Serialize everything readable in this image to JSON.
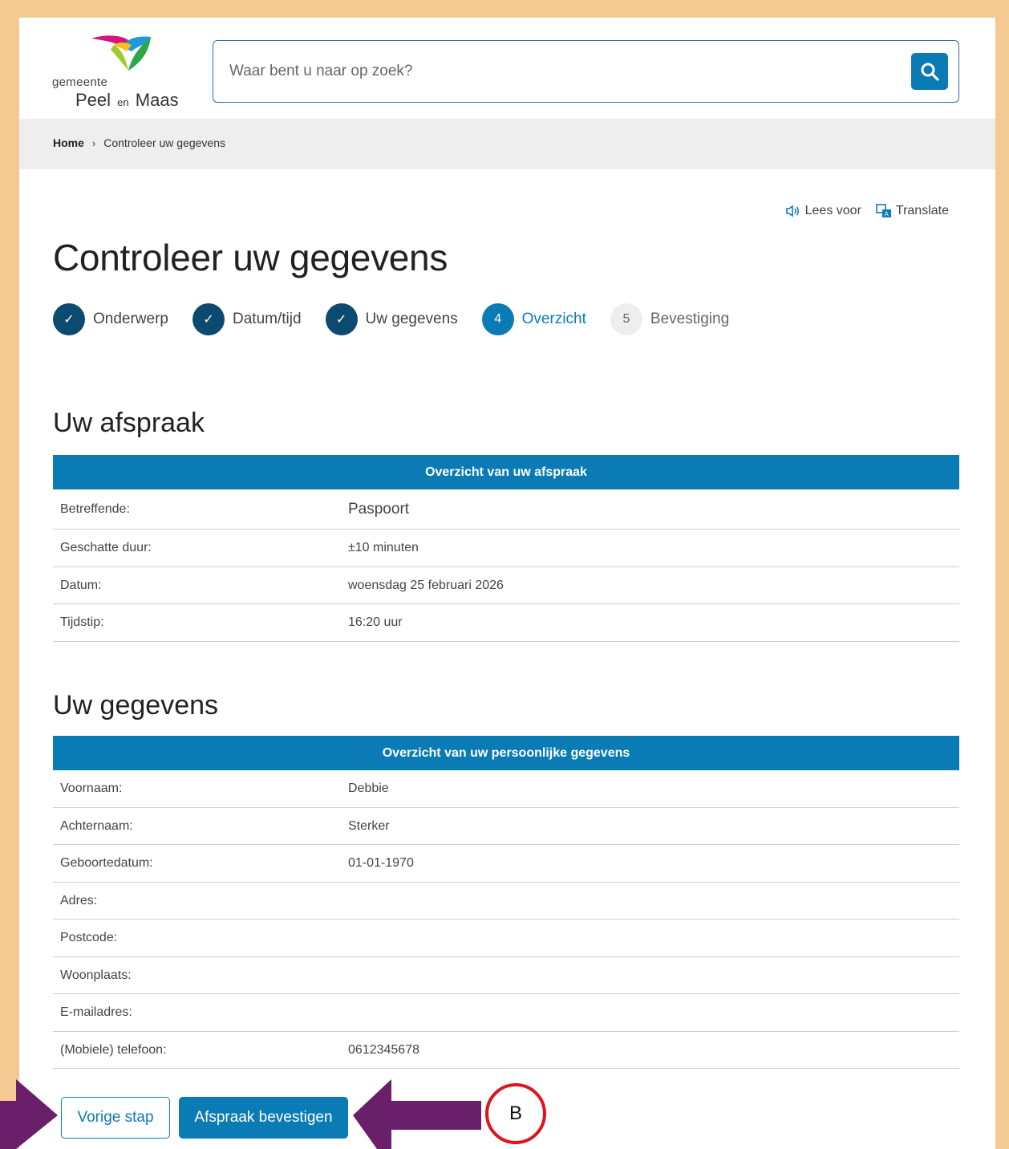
{
  "header": {
    "logo_gemeente": "gemeente",
    "logo_peel": "Peel",
    "logo_en": "en",
    "logo_maas": "Maas",
    "search_placeholder": "Waar bent u naar op zoek?"
  },
  "breadcrumb": {
    "home": "Home",
    "separator": "›",
    "current": "Controleer uw gegevens"
  },
  "tools": {
    "read_aloud": "Lees voor",
    "translate": "Translate"
  },
  "page_title": "Controleer uw gegevens",
  "steps": [
    {
      "label": "Onderwerp",
      "state": "done",
      "number": "✓"
    },
    {
      "label": "Datum/tijd",
      "state": "done",
      "number": "✓"
    },
    {
      "label": "Uw gegevens",
      "state": "done",
      "number": "✓"
    },
    {
      "label": "Overzicht",
      "state": "active",
      "number": "4"
    },
    {
      "label": "Bevestiging",
      "state": "todo",
      "number": "5"
    }
  ],
  "appointment": {
    "title": "Uw afspraak",
    "table_header": "Overzicht van uw afspraak",
    "rows": [
      {
        "key": "Betreffende:",
        "value": "Paspoort"
      },
      {
        "key": "Geschatte duur:",
        "value": "±10 minuten"
      },
      {
        "key": "Datum:",
        "value": "woensdag 25 februari 2026"
      },
      {
        "key": "Tijdstip:",
        "value": "16:20 uur"
      }
    ]
  },
  "personal": {
    "title": "Uw gegevens",
    "table_header": "Overzicht van uw persoonlijke gegevens",
    "rows": [
      {
        "key": "Voornaam:",
        "value": "Debbie"
      },
      {
        "key": "Achternaam:",
        "value": "Sterker"
      },
      {
        "key": "Geboortedatum:",
        "value": "01-01-1970"
      },
      {
        "key": "Adres:",
        "value": ""
      },
      {
        "key": "Postcode:",
        "value": ""
      },
      {
        "key": "Woonplaats:",
        "value": ""
      },
      {
        "key": "E-mailadres:",
        "value": ""
      },
      {
        "key": "(Mobiele) telefoon:",
        "value": "0612345678"
      }
    ]
  },
  "buttons": {
    "previous": "Vorige stap",
    "confirm": "Afspraak bevestigen"
  },
  "annotation": {
    "marker_label": "B"
  },
  "colors": {
    "primary": "#0b7bb5",
    "done_step": "#0d4a70",
    "frame": "#f5c992",
    "arrow": "#6a1f6b",
    "marker_ring": "#e0141c"
  }
}
